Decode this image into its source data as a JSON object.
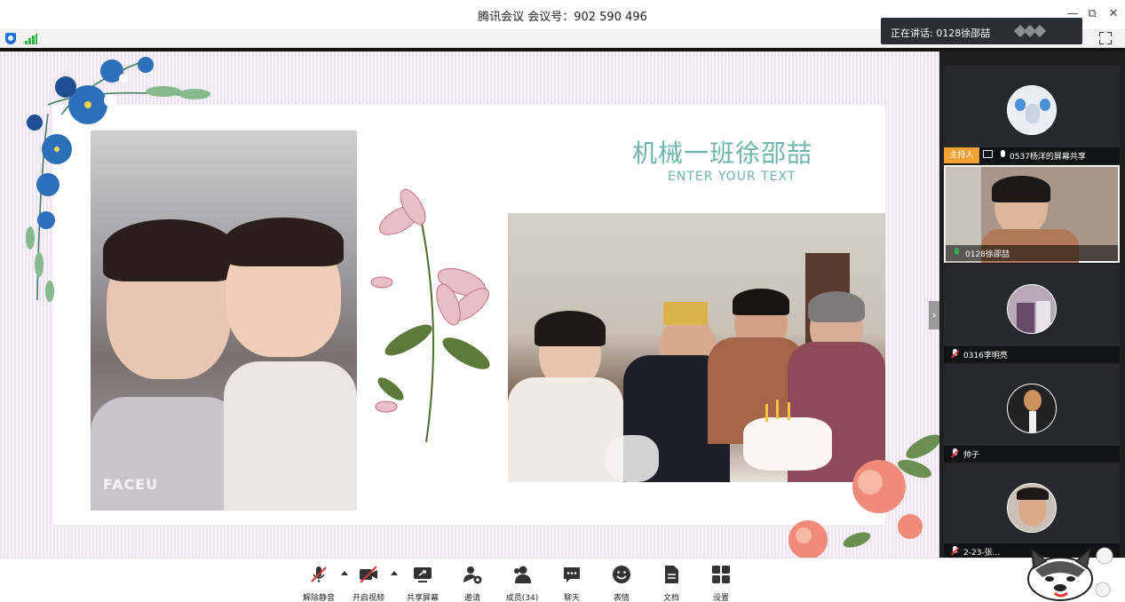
{
  "window": {
    "title": "腾讯会议  会议号：902 590 496",
    "minimize": "—",
    "restore": "⧉",
    "close": "✕"
  },
  "toast": {
    "text": "正在讲话: 0128徐邵喆"
  },
  "slide": {
    "title": "机械一班徐邵喆",
    "subtitle": "ENTER YOUR TEXT",
    "photo_watermark": "FACEU",
    "accent": "#6fb4ad"
  },
  "participants": [
    {
      "name": "0537杨洋的屏幕共享",
      "badge": "主持人",
      "icon": "screen-share-icon",
      "mic": "on"
    },
    {
      "name": "0128徐邵喆",
      "mic": "speaking",
      "active": true
    },
    {
      "name": "0316李明亮",
      "mic": "muted"
    },
    {
      "name": "帅子",
      "mic": "muted"
    },
    {
      "name": "2-23-张...",
      "mic": "muted"
    }
  ],
  "toolbar": {
    "unmute": "解除静音",
    "start_video": "开启视频",
    "share_screen": "共享屏幕",
    "invite": "邀请",
    "members": "成员(34)",
    "chat": "聊天",
    "reactions": "表情",
    "docs": "文档",
    "settings": "设置"
  },
  "colors": {
    "signal": "#2fb24c",
    "host_badge": "#f3a133",
    "muted_red": "#e33333",
    "mic_green": "#2fb24c"
  }
}
